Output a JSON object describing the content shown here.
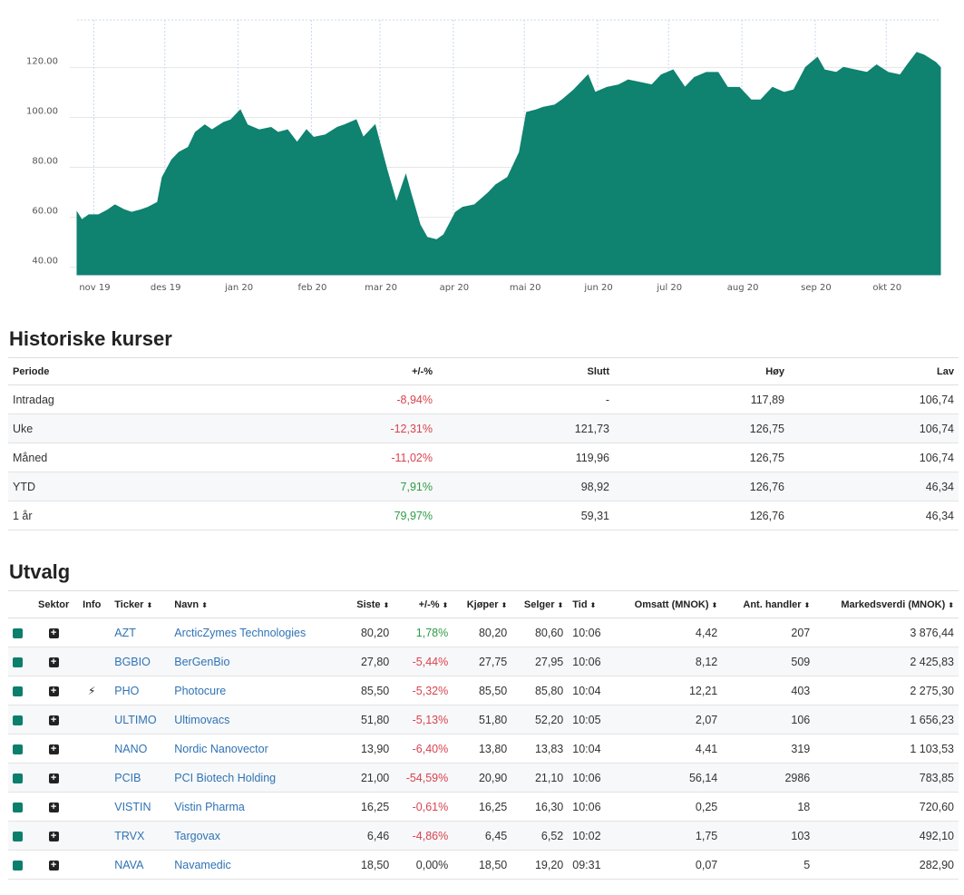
{
  "chart_data": {
    "type": "area",
    "color": "#0f8270",
    "x_labels": [
      "nov 19",
      "des 19",
      "jan 20",
      "feb 20",
      "mar 20",
      "apr 20",
      "mai 20",
      "jun 20",
      "jul 20",
      "aug 20",
      "sep 20",
      "okt 20"
    ],
    "y_ticks": [
      "40.00",
      "60.00",
      "80.00",
      "100.00",
      "120.00"
    ],
    "ylim": [
      37,
      139
    ],
    "grid": "vertical dashed",
    "x": [
      "2019-10-23",
      "2019-10-25",
      "2019-10-28",
      "2019-11-01",
      "2019-11-05",
      "2019-11-08",
      "2019-11-12",
      "2019-11-15",
      "2019-11-19",
      "2019-11-22",
      "2019-11-26",
      "2019-11-28",
      "2019-12-02",
      "2019-12-05",
      "2019-12-09",
      "2019-12-12",
      "2019-12-16",
      "2019-12-19",
      "2019-12-24",
      "2019-12-27",
      "2019-12-31",
      "2020-01-03",
      "2020-01-08",
      "2020-01-13",
      "2020-01-16",
      "2020-01-20",
      "2020-01-24",
      "2020-01-28",
      "2020-01-31",
      "2020-02-05",
      "2020-02-10",
      "2020-02-13",
      "2020-02-18",
      "2020-02-21",
      "2020-02-26",
      "2020-03-02",
      "2020-03-06",
      "2020-03-10",
      "2020-03-12",
      "2020-03-16",
      "2020-03-19",
      "2020-03-23",
      "2020-03-26",
      "2020-03-31",
      "2020-04-03",
      "2020-04-08",
      "2020-04-14",
      "2020-04-17",
      "2020-04-22",
      "2020-04-27",
      "2020-04-30",
      "2020-05-04",
      "2020-05-07",
      "2020-05-12",
      "2020-05-15",
      "2020-05-20",
      "2020-05-26",
      "2020-05-29",
      "2020-06-03",
      "2020-06-08",
      "2020-06-12",
      "2020-06-17",
      "2020-06-22",
      "2020-06-26",
      "2020-07-01",
      "2020-07-06",
      "2020-07-10",
      "2020-07-15",
      "2020-07-20",
      "2020-07-24",
      "2020-07-29",
      "2020-08-03",
      "2020-08-07",
      "2020-08-12",
      "2020-08-17",
      "2020-08-21",
      "2020-08-26",
      "2020-08-31",
      "2020-09-03",
      "2020-09-08",
      "2020-09-11",
      "2020-09-16",
      "2020-09-21",
      "2020-09-25",
      "2020-09-30",
      "2020-10-05",
      "2020-10-08",
      "2020-10-12",
      "2020-10-15",
      "2020-10-20",
      "2020-10-22"
    ],
    "y": [
      62,
      59,
      61,
      61,
      63,
      65,
      63,
      62,
      63,
      64,
      66,
      76,
      83,
      86,
      88,
      94,
      97,
      95,
      98,
      99,
      103,
      97,
      95,
      96,
      94,
      95,
      90,
      95,
      92,
      93,
      96,
      97,
      99,
      92,
      97,
      79,
      66,
      77,
      70,
      57,
      52,
      51,
      53,
      62,
      64,
      65,
      70,
      73,
      76,
      86,
      102,
      103,
      104,
      105,
      107,
      111,
      117,
      110,
      112,
      113,
      115,
      114,
      113,
      117,
      119,
      112,
      116,
      118,
      118,
      112,
      112,
      107,
      107,
      112,
      110,
      111,
      120,
      124,
      119,
      118,
      120,
      119,
      118,
      121,
      118,
      117,
      121,
      126,
      125,
      122,
      120
    ]
  },
  "historical": {
    "title": "Historiske kurser",
    "headers": [
      "Periode",
      "+/-%",
      "Slutt",
      "Høy",
      "Lav"
    ],
    "rows": [
      {
        "periode": "Intradag",
        "pct": "-8,94%",
        "slutt": "-",
        "hoy": "117,89",
        "lav": "106,74",
        "sign": "neg"
      },
      {
        "periode": "Uke",
        "pct": "-12,31%",
        "slutt": "121,73",
        "hoy": "126,75",
        "lav": "106,74",
        "sign": "neg"
      },
      {
        "periode": "Måned",
        "pct": "-11,02%",
        "slutt": "119,96",
        "hoy": "126,75",
        "lav": "106,74",
        "sign": "neg"
      },
      {
        "periode": "YTD",
        "pct": "7,91%",
        "slutt": "98,92",
        "hoy": "126,76",
        "lav": "46,34",
        "sign": "pos"
      },
      {
        "periode": "1 år",
        "pct": "79,97%",
        "slutt": "59,31",
        "hoy": "126,76",
        "lav": "46,34",
        "sign": "pos"
      }
    ]
  },
  "selection": {
    "title": "Utvalg",
    "headers": {
      "sektor": "Sektor",
      "info": "Info",
      "ticker": "Ticker",
      "navn": "Navn",
      "siste": "Siste",
      "pct": "+/-%",
      "kjoper": "Kjøper",
      "selger": "Selger",
      "tid": "Tid",
      "omsatt": "Omsatt (MNOK)",
      "handler": "Ant. handler",
      "mverdi": "Markedsverdi (MNOK)"
    },
    "sort_icon": "⬍",
    "sector_color": "#0c7e6c",
    "rows": [
      {
        "ticker": "AZT",
        "navn": "ArcticZymes Technologies",
        "siste": "80,20",
        "pct": "1,78%",
        "sign": "pos",
        "kjoper": "80,20",
        "selger": "80,60",
        "tid": "10:06",
        "omsatt": "4,42",
        "handler": "207",
        "mverdi": "3 876,44",
        "info": ""
      },
      {
        "ticker": "BGBIO",
        "navn": "BerGenBio",
        "siste": "27,80",
        "pct": "-5,44%",
        "sign": "neg",
        "kjoper": "27,75",
        "selger": "27,95",
        "tid": "10:06",
        "omsatt": "8,12",
        "handler": "509",
        "mverdi": "2 425,83",
        "info": ""
      },
      {
        "ticker": "PHO",
        "navn": "Photocure",
        "siste": "85,50",
        "pct": "-5,32%",
        "sign": "neg",
        "kjoper": "85,50",
        "selger": "85,80",
        "tid": "10:04",
        "omsatt": "12,21",
        "handler": "403",
        "mverdi": "2 275,30",
        "info": "⚡"
      },
      {
        "ticker": "ULTIMO",
        "navn": "Ultimovacs",
        "siste": "51,80",
        "pct": "-5,13%",
        "sign": "neg",
        "kjoper": "51,80",
        "selger": "52,20",
        "tid": "10:05",
        "omsatt": "2,07",
        "handler": "106",
        "mverdi": "1 656,23",
        "info": ""
      },
      {
        "ticker": "NANO",
        "navn": "Nordic Nanovector",
        "siste": "13,90",
        "pct": "-6,40%",
        "sign": "neg",
        "kjoper": "13,80",
        "selger": "13,83",
        "tid": "10:04",
        "omsatt": "4,41",
        "handler": "319",
        "mverdi": "1 103,53",
        "info": ""
      },
      {
        "ticker": "PCIB",
        "navn": "PCI Biotech Holding",
        "siste": "21,00",
        "pct": "-54,59%",
        "sign": "neg",
        "kjoper": "20,90",
        "selger": "21,10",
        "tid": "10:06",
        "omsatt": "56,14",
        "handler": "2986",
        "mverdi": "783,85",
        "info": ""
      },
      {
        "ticker": "VISTIN",
        "navn": "Vistin Pharma",
        "siste": "16,25",
        "pct": "-0,61%",
        "sign": "neg",
        "kjoper": "16,25",
        "selger": "16,30",
        "tid": "10:06",
        "omsatt": "0,25",
        "handler": "18",
        "mverdi": "720,60",
        "info": ""
      },
      {
        "ticker": "TRVX",
        "navn": "Targovax",
        "siste": "6,46",
        "pct": "-4,86%",
        "sign": "neg",
        "kjoper": "6,45",
        "selger": "6,52",
        "tid": "10:02",
        "omsatt": "1,75",
        "handler": "103",
        "mverdi": "492,10",
        "info": ""
      },
      {
        "ticker": "NAVA",
        "navn": "Navamedic",
        "siste": "18,50",
        "pct": "0,00%",
        "sign": "zero",
        "kjoper": "18,50",
        "selger": "19,20",
        "tid": "09:31",
        "omsatt": "0,07",
        "handler": "5",
        "mverdi": "282,90",
        "info": ""
      }
    ]
  }
}
